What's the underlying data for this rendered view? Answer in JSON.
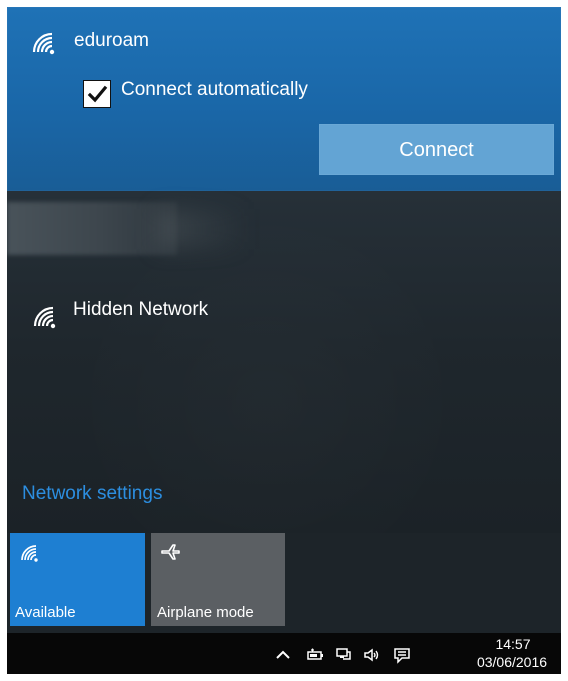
{
  "networks": {
    "selected": {
      "name": "eduroam",
      "icon": "wifi-icon",
      "connect_automatically_label": "Connect automatically",
      "connect_button_label": "Connect"
    },
    "hidden": {
      "name": "Hidden Network",
      "icon": "wifi-icon"
    }
  },
  "settings": {
    "network_settings_label": "Network settings"
  },
  "quick_actions": [
    {
      "label": "Available",
      "icon": "wifi-icon",
      "color": "#1e7fd2"
    },
    {
      "label": "Airplane mode",
      "icon": "airplane-icon",
      "color": "#5b5f63"
    }
  ],
  "taskbar": {
    "time": "14:57",
    "date": "03/06/2016",
    "icons": [
      "chevron-up-icon",
      "battery-icon",
      "network-icon",
      "volume-icon",
      "notification-icon"
    ]
  },
  "colors": {
    "accent": "#1f72b6",
    "link": "#2c8ee0",
    "button": "#63a4d4",
    "background": "#1d2429"
  }
}
